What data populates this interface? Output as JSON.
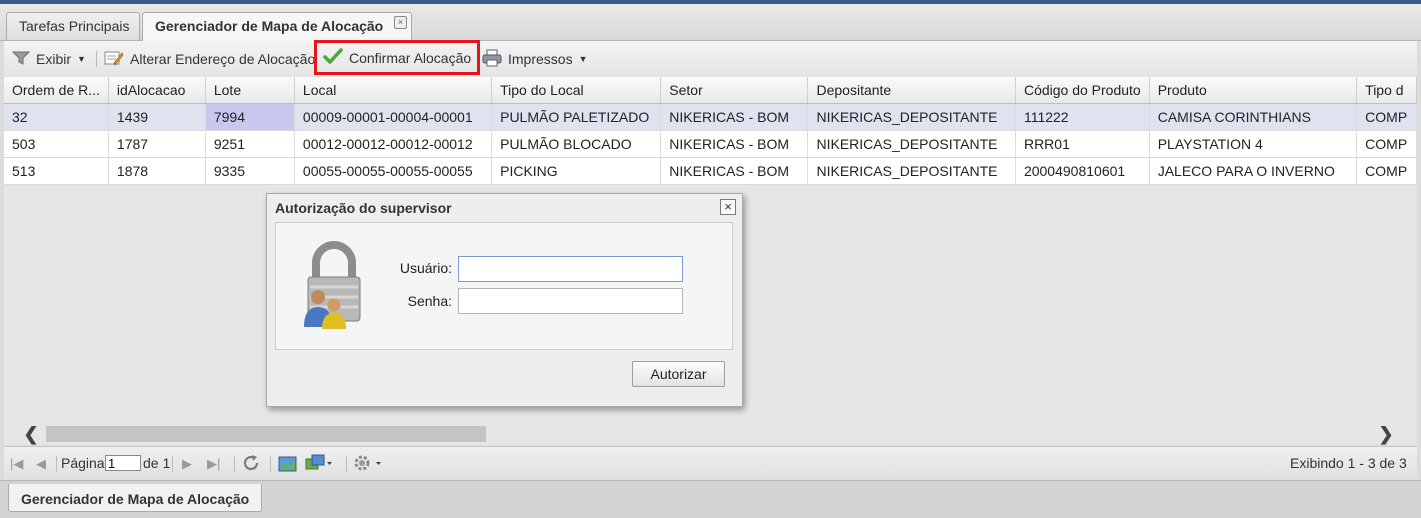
{
  "tabs": [
    {
      "label": "Tarefas Principais"
    },
    {
      "label": "Gerenciador de Mapa de Alocação",
      "close": "×"
    }
  ],
  "toolbar": {
    "exibir": "Exibir",
    "alterar_endereco": "Alterar Endereço de Alocação",
    "confirmar_alocacao": "Confirmar Alocação",
    "impressos": "Impressos",
    "highlight_color": "#e2161b"
  },
  "grid": {
    "columns": [
      "Ordem de R...",
      "idAlocacao",
      "Lote",
      "Local",
      "Tipo do Local",
      "Setor",
      "Depositante",
      "Código do Produto",
      "Produto",
      "Tipo d"
    ],
    "rows": [
      [
        "32",
        "1439",
        "7994",
        "00009-00001-00004-00001",
        "PULMÃO PALETIZADO",
        "NIKERICAS - BOM",
        "NIKERICAS_DEPOSITANTE",
        "111222",
        "CAMISA CORINTHIANS",
        "COMP"
      ],
      [
        "503",
        "1787",
        "9251",
        "00012-00012-00012-00012",
        "PULMÃO BLOCADO",
        "NIKERICAS - BOM",
        "NIKERICAS_DEPOSITANTE",
        "RRR01",
        "PLAYSTATION 4",
        "COMP"
      ],
      [
        "513",
        "1878",
        "9335",
        "00055-00055-00055-00055",
        "PICKING",
        "NIKERICAS - BOM",
        "NIKERICAS_DEPOSITANTE",
        "2000490810601",
        "JALECO PARA O INVERNO",
        "COMP"
      ]
    ]
  },
  "pager": {
    "page_label": "Página",
    "page_value": "1",
    "of_label": "de 1",
    "status": "Exibindo 1 - 3 de 3"
  },
  "dialog": {
    "title": "Autorização do supervisor",
    "close": "×",
    "user_label": "Usuário:",
    "user_value": "",
    "password_label": "Senha:",
    "password_value": "",
    "submit": "Autorizar"
  },
  "bottom_tab": {
    "label": "Gerenciador de Mapa de Alocação"
  },
  "icons": {
    "exibir": "funnel-icon",
    "alterar": "edit-address-icon",
    "confirmar": "check-icon",
    "impressos": "printer-icon",
    "dialog": "lock-users-icon"
  }
}
